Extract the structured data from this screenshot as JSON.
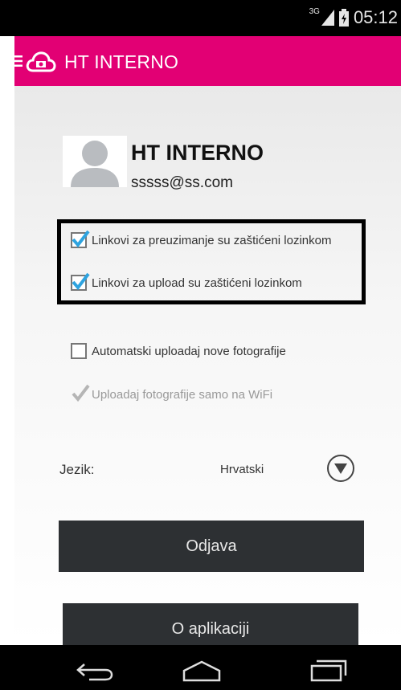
{
  "status_bar": {
    "network": "3G",
    "time": "05:12"
  },
  "app_bar": {
    "title": "HT INTERNO",
    "accent_color": "#e20074"
  },
  "profile": {
    "name": "HT INTERNO",
    "email": "sssss@ss.com"
  },
  "options": [
    {
      "label": "Linkovi za preuzimanje su zaštićeni lozinkom",
      "checked": true,
      "enabled": true
    },
    {
      "label": "Linkovi za upload su zaštićeni lozinkom",
      "checked": true,
      "enabled": true
    },
    {
      "label": "Automatski uploadaj nove fotografije",
      "checked": false,
      "enabled": true
    },
    {
      "label": "Uploadaj fotografije samo na WiFi",
      "checked": true,
      "enabled": false
    }
  ],
  "language": {
    "label": "Jezik:",
    "value": "Hrvatski"
  },
  "buttons": {
    "logout": "Odjava",
    "about": "O aplikaciji"
  },
  "icons": [
    "menu-icon",
    "cloud-icon",
    "signal-icon",
    "battery-icon",
    "dropdown-arrow-icon",
    "back-icon",
    "home-icon",
    "recent-apps-icon"
  ]
}
